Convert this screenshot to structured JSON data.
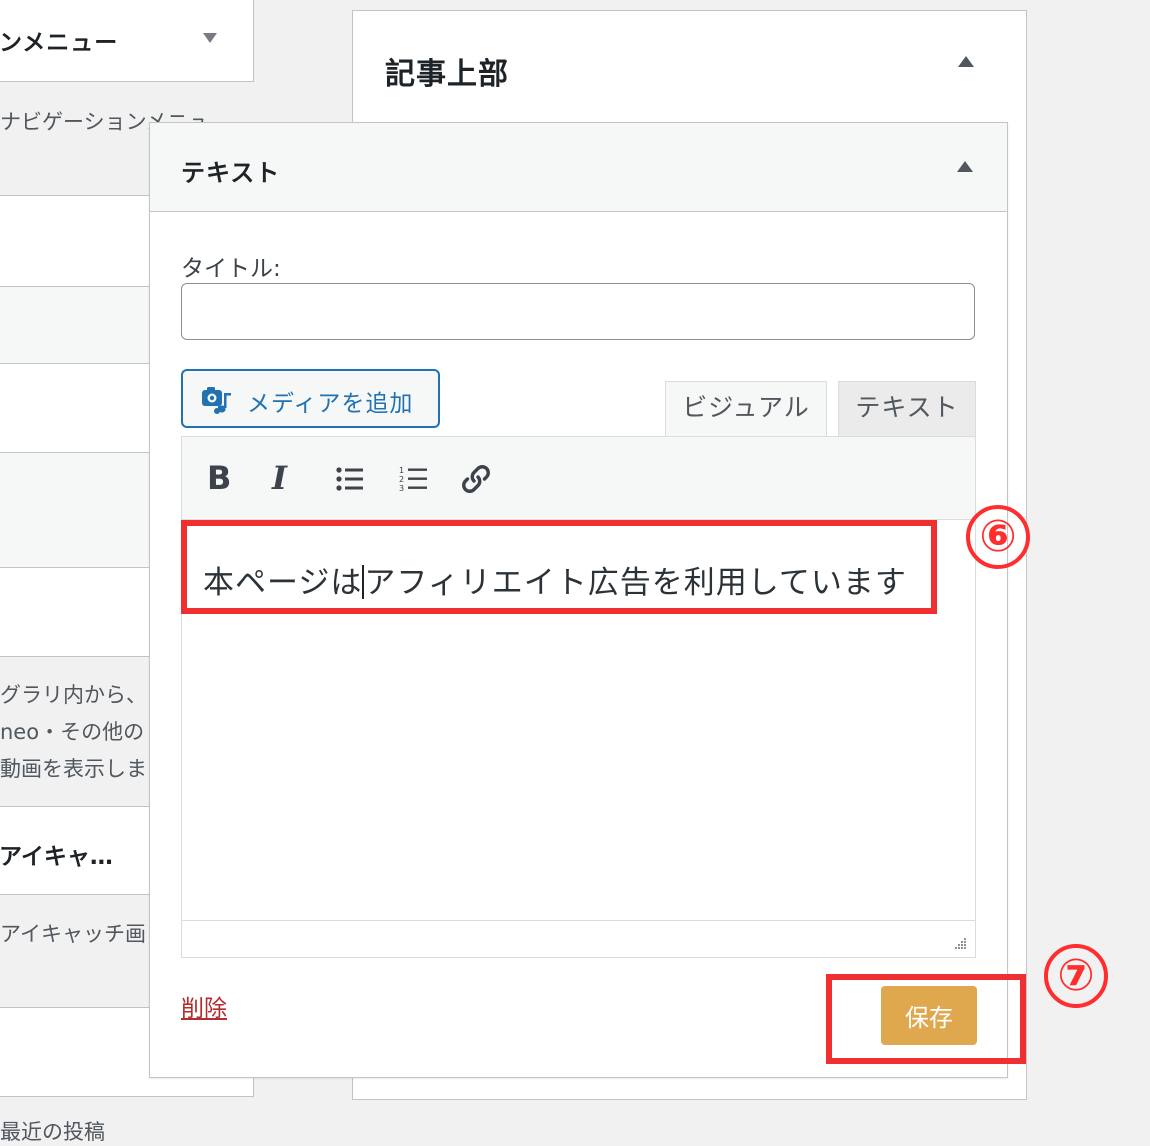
{
  "left_column": {
    "menu_widget_title": "ンメニュー",
    "menu_widget_desc": "ナビゲーションメニュ",
    "video_desc_lines": [
      "グラリ内から、",
      "neo・その他の",
      "動画を表示しま"
    ],
    "featured_widget_title": "アイキャ…",
    "featured_desc": "アイキャッチ画",
    "bottom_desc": "最近の投稿"
  },
  "area": {
    "title": "記事上部"
  },
  "widget": {
    "title": "テキスト",
    "title_field_label": "タイトル:",
    "title_field_value": "",
    "media_button_label": "メディアを追加",
    "tabs": [
      {
        "label": "ビジュアル",
        "active": true
      },
      {
        "label": "テキスト",
        "active": false
      }
    ],
    "toolbar": [
      "bold-icon",
      "italic-icon",
      "bulleted-list-icon",
      "numbered-list-icon",
      "link-icon"
    ],
    "content_before_caret": "本ページは",
    "content_after_caret": "アフィリエイト広告を利用しています",
    "delete_label": "削除",
    "save_label": "保存"
  },
  "annotations": {
    "step6": "⑥",
    "step7": "⑦",
    "color": "#f03030"
  },
  "colors": {
    "accent_blue": "#2271b1",
    "save_button": "#e0a84e",
    "delete_link": "#b32d2e"
  }
}
